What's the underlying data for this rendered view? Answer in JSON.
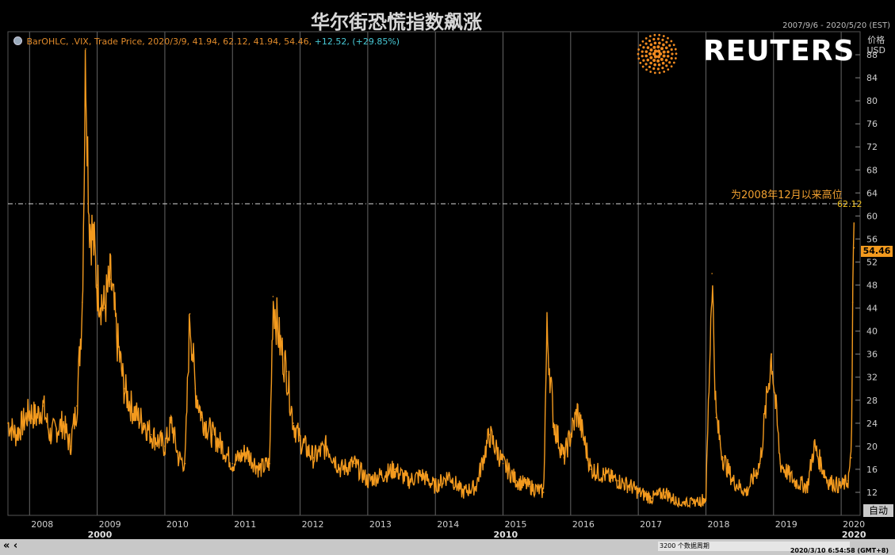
{
  "chart_data": {
    "type": "line",
    "title": "华尔街恐慌指数飙涨",
    "date_range": "2007/9/6 - 2020/5/20 (EST)",
    "y_axis_title": "价格",
    "y_axis_unit": "USD",
    "legend": {
      "text": "BarOHLC, .VIX, Trade Price, 2020/3/9, 41.94, 62.12, 41.94, 54.46,",
      "change": "+12.52, (+29.85%)"
    },
    "annotation": "为2008年12月以来高位",
    "high_line": {
      "value": 62.12,
      "label": "62.12"
    },
    "last_price": {
      "value": 54.46,
      "label": "54.46"
    },
    "ylim": [
      8,
      92
    ],
    "y_ticks": [
      12,
      16,
      20,
      24,
      28,
      32,
      36,
      40,
      44,
      48,
      52,
      56,
      60,
      64,
      68,
      72,
      76,
      80,
      84,
      88
    ],
    "x_ticks": [
      "2008",
      "2009",
      "2010",
      "2011",
      "2012",
      "2013",
      "2014",
      "2015",
      "2016",
      "2017",
      "2018",
      "2019",
      "2020"
    ],
    "x_decades": [
      "2000",
      "2010",
      "2020"
    ],
    "x": [
      2007.68,
      2007.8,
      2007.9,
      2008.0,
      2008.1,
      2008.2,
      2008.3,
      2008.4,
      2008.5,
      2008.6,
      2008.7,
      2008.78,
      2008.83,
      2008.88,
      2008.95,
      2009.0,
      2009.1,
      2009.2,
      2009.3,
      2009.4,
      2009.5,
      2009.6,
      2009.7,
      2009.8,
      2009.9,
      2010.0,
      2010.1,
      2010.2,
      2010.3,
      2010.37,
      2010.45,
      2010.55,
      2010.7,
      2010.85,
      2011.0,
      2011.2,
      2011.4,
      2011.55,
      2011.6,
      2011.7,
      2011.8,
      2011.9,
      2012.0,
      2012.2,
      2012.4,
      2012.6,
      2012.8,
      2013.0,
      2013.2,
      2013.4,
      2013.6,
      2013.8,
      2014.0,
      2014.2,
      2014.4,
      2014.6,
      2014.8,
      2015.0,
      2015.2,
      2015.4,
      2015.6,
      2015.65,
      2015.75,
      2015.9,
      2016.0,
      2016.1,
      2016.3,
      2016.5,
      2016.7,
      2016.9,
      2017.0,
      2017.2,
      2017.4,
      2017.6,
      2017.8,
      2018.0,
      2018.09,
      2018.15,
      2018.25,
      2018.4,
      2018.6,
      2018.8,
      2018.97,
      2019.1,
      2019.3,
      2019.5,
      2019.6,
      2019.8,
      2020.0,
      2020.1,
      2020.15,
      2020.17,
      2020.19
    ],
    "values": [
      24,
      22,
      24,
      26,
      25,
      27,
      22,
      23,
      24,
      20,
      27,
      45,
      89,
      60,
      55,
      48,
      44,
      49,
      38,
      30,
      27,
      25,
      24,
      22,
      21,
      20,
      24,
      18,
      17,
      43,
      30,
      25,
      22,
      20,
      17,
      19,
      16,
      17,
      46,
      38,
      33,
      24,
      21,
      18,
      20,
      16,
      17,
      14,
      15,
      16,
      14,
      15,
      13,
      15,
      12,
      13,
      22,
      17,
      14,
      13,
      12,
      40,
      24,
      18,
      22,
      26,
      16,
      15,
      14,
      13,
      12,
      11,
      12,
      10,
      10,
      11,
      50,
      25,
      18,
      14,
      12,
      17,
      36,
      17,
      14,
      13,
      20,
      14,
      13,
      14,
      18,
      45,
      54.46
    ],
    "series_color": "#f39a1e"
  },
  "ui": {
    "logo_text": "REUTERS",
    "auto_button": "自动",
    "points_box": "3200 个数据周期",
    "timestamp": "2020/3/10 6:54:58 (GMT+8)",
    "nav_left": "«  ‹",
    "nav_right": "»"
  }
}
